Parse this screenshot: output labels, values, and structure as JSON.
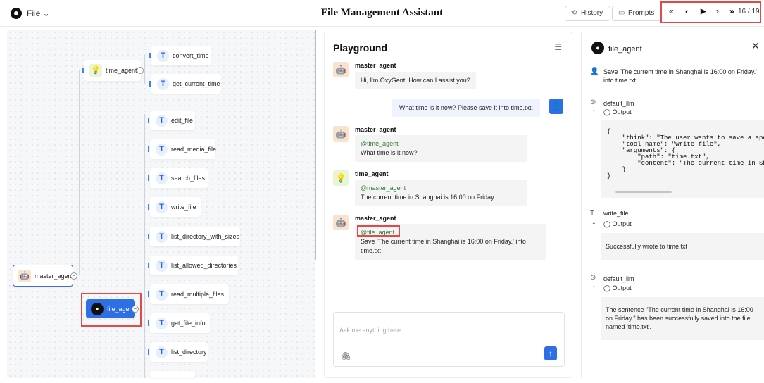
{
  "header": {
    "menu_label": "File ⌄",
    "title": "File Management Assistant",
    "history_label": "History",
    "prompts_label": "Prompts",
    "nav": {
      "first": "«",
      "prev": "‹",
      "play": "▶",
      "next": "›",
      "last": "»",
      "counter": "16 / 19"
    }
  },
  "graph": {
    "root": {
      "label": "master_agent",
      "icon": "robot-icon"
    },
    "agents": [
      {
        "label": "time_agent",
        "icon": "lightbulb-icon"
      },
      {
        "label": "file_agent",
        "icon": "circle-agent-icon",
        "selected": true
      }
    ],
    "time_tools": [
      "convert_time",
      "get_current_time"
    ],
    "file_tools": [
      "edit_file",
      "read_media_file",
      "search_files",
      "write_file",
      "list_directory_with_sizes",
      "list_allowed_directories",
      "read_multiple_files",
      "get_file_info",
      "list_directory"
    ]
  },
  "playground": {
    "title": "Playground",
    "messages": [
      {
        "sender": "master_agent",
        "avatar": "robot-icon",
        "text": "Hi, I'm OxyGent. How can I assist you?"
      },
      {
        "sender": "user",
        "avatar": "user-icon",
        "text": "What time is it now? Please save it into time.txt."
      },
      {
        "sender": "master_agent",
        "avatar": "robot-icon",
        "mention": "@time_agent",
        "text": "What time is it now?"
      },
      {
        "sender": "time_agent",
        "avatar": "lightbulb-icon",
        "mention": "@master_agent",
        "text": "The current time in Shanghai is 16:00 on Friday."
      },
      {
        "sender": "master_agent",
        "avatar": "robot-icon",
        "mention": "@file_agent",
        "text": "Save 'The current time in Shanghai is 16:00 on Friday.' into time.txt"
      }
    ],
    "input_placeholder": "Ask me anything here."
  },
  "detail": {
    "title": "file_agent",
    "query": "Save 'The current time in Shanghai is 16:00 on Friday.' into time.txt",
    "steps": [
      {
        "name": "default_llm",
        "output_label": "Output",
        "code": "{\n    \"think\": \"The user wants to save a specif\n    \"tool_name\": \"write_file\",\n    \"arguments\": {\n        \"path\": \"time.txt\",\n        \"content\": \"The current time in Shang\n    }\n}"
      },
      {
        "name": "write_file",
        "output_label": "Output",
        "result": "Successfully wrote to time.txt"
      },
      {
        "name": "default_llm",
        "output_label": "Output",
        "result": "The sentence \"The current time in Shanghai is 16:00 on Friday.\" has been successfully saved into the file named 'time.txt'."
      }
    ]
  },
  "colors": {
    "accent": "#2f6fe4",
    "highlight": "#e24a4a",
    "mention": "#2f7a2f"
  }
}
